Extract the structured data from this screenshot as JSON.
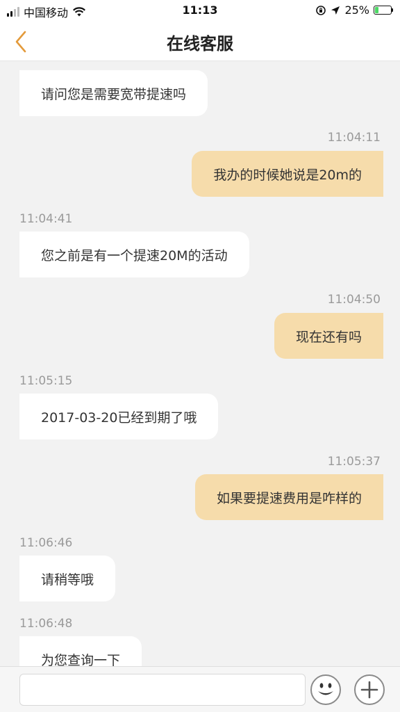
{
  "status_bar": {
    "carrier": "中国移动",
    "time": "11:13",
    "battery": "25%",
    "battery_level": 0.25,
    "icons": [
      "signal-icon",
      "wifi-icon",
      "orientation-lock-icon",
      "location-icon",
      "battery-icon"
    ]
  },
  "nav": {
    "title": "在线客服",
    "back_icon": "chevron-left-icon",
    "accent": "#e39a3b"
  },
  "messages": [
    {
      "side": "in",
      "time": "",
      "text": "请问您是需要宽带提速吗"
    },
    {
      "side": "out",
      "time": "11:04:11",
      "text": "我办的时候她说是20m的"
    },
    {
      "side": "in",
      "time": "11:04:41",
      "text": "您之前是有一个提速20M的活动"
    },
    {
      "side": "out",
      "time": "11:04:50",
      "text": "现在还有吗"
    },
    {
      "side": "in",
      "time": "11:05:15",
      "text": "2017-03-20已经到期了哦"
    },
    {
      "side": "out",
      "time": "11:05:37",
      "text": "如果要提速费用是咋样的"
    },
    {
      "side": "in",
      "time": "11:06:46",
      "text": "请稍等哦"
    },
    {
      "side": "in",
      "time": "11:06:48",
      "text": "为您查询一下"
    }
  ],
  "input": {
    "value": "",
    "placeholder": "",
    "emoji_icon": "emoji-icon",
    "plus_icon": "plus-icon"
  },
  "colors": {
    "outgoing_bubble": "#f6dcab",
    "incoming_bubble": "#ffffff",
    "background": "#f2f2f2",
    "timestamp": "#9a9a9a"
  }
}
